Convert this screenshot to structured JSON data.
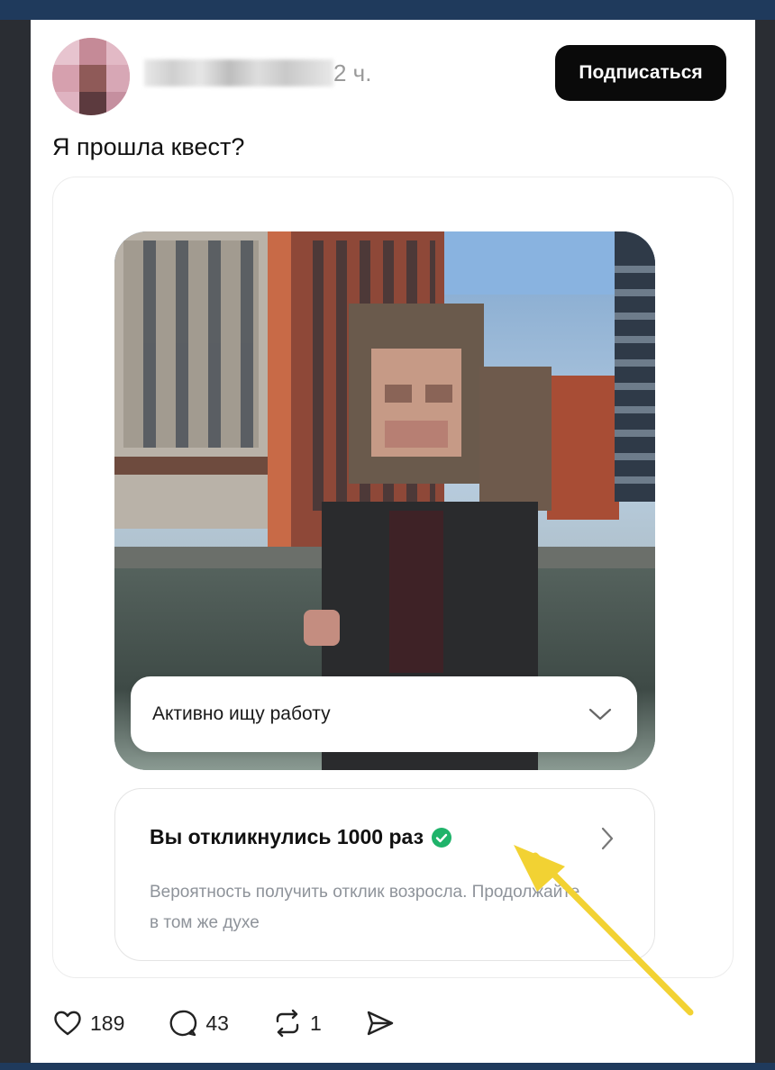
{
  "header": {
    "time": "2 ч.",
    "subscribe_label": "Подписаться"
  },
  "post": {
    "text": "Я прошла квест?"
  },
  "embed": {
    "dropdown_label": "Активно ищу работу",
    "stat_title": "Вы откликнулись 1000 раз",
    "stat_desc": "Вероятность получить отклик возросла. Продолжайте в том же духе"
  },
  "actions": {
    "likes": "189",
    "comments": "43",
    "reposts": "1"
  },
  "colors": {
    "accent_check": "#1fb36a",
    "annotation_arrow": "#f2d233",
    "button_bg": "#0a0a0a"
  },
  "icons": {
    "like": "heart-icon",
    "comment": "comment-icon",
    "repost": "repost-icon",
    "share": "send-icon"
  }
}
